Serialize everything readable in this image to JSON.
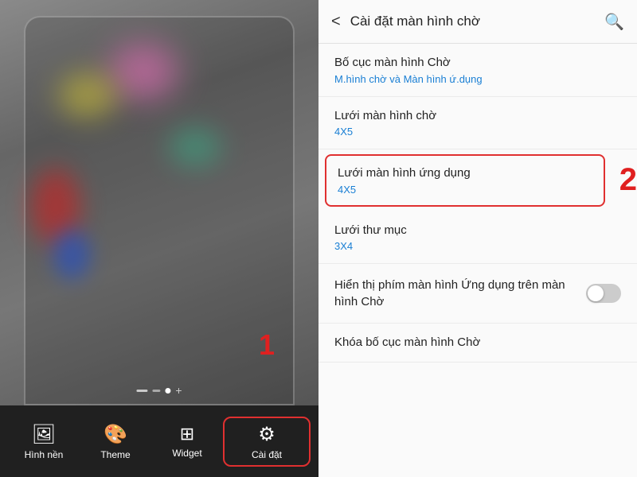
{
  "left": {
    "dots": [
      "dash",
      "rect",
      "circle",
      "plus"
    ],
    "badge": "1",
    "nav": [
      {
        "id": "hinh-nen",
        "label": "Hình nền",
        "icon": "🖼",
        "active": false
      },
      {
        "id": "theme",
        "label": "Theme",
        "icon": "🎨",
        "active": false
      },
      {
        "id": "widget",
        "label": "Widget",
        "icon": "⊞",
        "active": false
      },
      {
        "id": "cai-dat",
        "label": "Cài đặt",
        "icon": "⚙",
        "active": true
      }
    ]
  },
  "right": {
    "header": {
      "title": "Cài đặt màn hình chờ",
      "back_label": "<",
      "search_label": "🔍"
    },
    "items": [
      {
        "id": "bo-cuc",
        "title": "Bố cục màn hình Chờ",
        "sub": "M.hình chờ và Màn hình ứ.dụng",
        "type": "link",
        "highlighted": false
      },
      {
        "id": "luoi-man-hinh-cho",
        "title": "Lưới màn hình chờ",
        "sub": "4X5",
        "type": "link",
        "highlighted": false
      },
      {
        "id": "luoi-man-hinh-ung-dung",
        "title": "Lưới màn hình ứng dụng",
        "sub": "4X5",
        "type": "link",
        "highlighted": true
      },
      {
        "id": "luoi-thu-muc",
        "title": "Lưới thư mục",
        "sub": "3X4",
        "type": "link",
        "highlighted": false
      },
      {
        "id": "hien-thi-phim",
        "title": "Hiển thị phím màn hình Ứng dụng trên màn hình Chờ",
        "type": "toggle",
        "toggle_on": false
      },
      {
        "id": "khoa-bo-cuc",
        "title": "Khóa bố cục màn hình Chờ",
        "type": "link",
        "highlighted": false
      }
    ],
    "badge": "2"
  }
}
